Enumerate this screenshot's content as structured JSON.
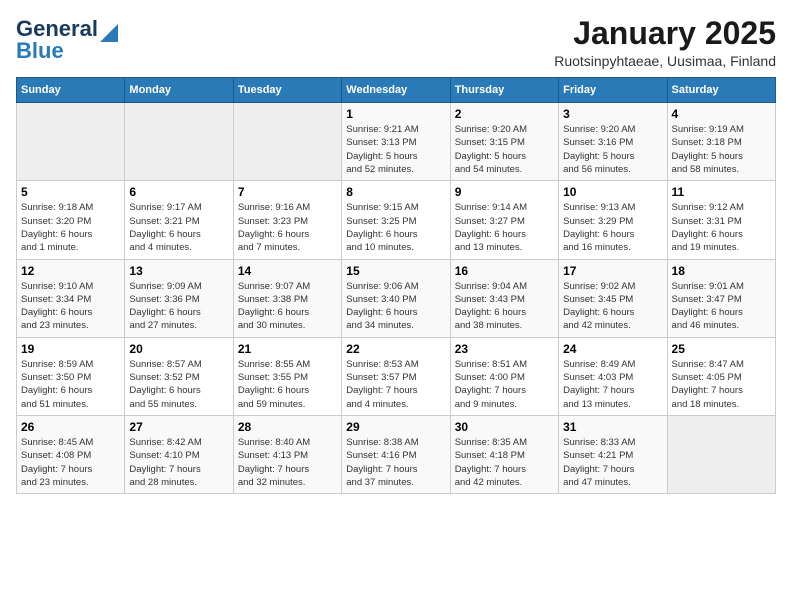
{
  "logo": {
    "line1": "General",
    "line2": "Blue"
  },
  "title": "January 2025",
  "subtitle": "Ruotsinpyhtaeae, Uusimaa, Finland",
  "days_of_week": [
    "Sunday",
    "Monday",
    "Tuesday",
    "Wednesday",
    "Thursday",
    "Friday",
    "Saturday"
  ],
  "weeks": [
    [
      {
        "day": "",
        "info": ""
      },
      {
        "day": "",
        "info": ""
      },
      {
        "day": "",
        "info": ""
      },
      {
        "day": "1",
        "info": "Sunrise: 9:21 AM\nSunset: 3:13 PM\nDaylight: 5 hours\nand 52 minutes."
      },
      {
        "day": "2",
        "info": "Sunrise: 9:20 AM\nSunset: 3:15 PM\nDaylight: 5 hours\nand 54 minutes."
      },
      {
        "day": "3",
        "info": "Sunrise: 9:20 AM\nSunset: 3:16 PM\nDaylight: 5 hours\nand 56 minutes."
      },
      {
        "day": "4",
        "info": "Sunrise: 9:19 AM\nSunset: 3:18 PM\nDaylight: 5 hours\nand 58 minutes."
      }
    ],
    [
      {
        "day": "5",
        "info": "Sunrise: 9:18 AM\nSunset: 3:20 PM\nDaylight: 6 hours\nand 1 minute."
      },
      {
        "day": "6",
        "info": "Sunrise: 9:17 AM\nSunset: 3:21 PM\nDaylight: 6 hours\nand 4 minutes."
      },
      {
        "day": "7",
        "info": "Sunrise: 9:16 AM\nSunset: 3:23 PM\nDaylight: 6 hours\nand 7 minutes."
      },
      {
        "day": "8",
        "info": "Sunrise: 9:15 AM\nSunset: 3:25 PM\nDaylight: 6 hours\nand 10 minutes."
      },
      {
        "day": "9",
        "info": "Sunrise: 9:14 AM\nSunset: 3:27 PM\nDaylight: 6 hours\nand 13 minutes."
      },
      {
        "day": "10",
        "info": "Sunrise: 9:13 AM\nSunset: 3:29 PM\nDaylight: 6 hours\nand 16 minutes."
      },
      {
        "day": "11",
        "info": "Sunrise: 9:12 AM\nSunset: 3:31 PM\nDaylight: 6 hours\nand 19 minutes."
      }
    ],
    [
      {
        "day": "12",
        "info": "Sunrise: 9:10 AM\nSunset: 3:34 PM\nDaylight: 6 hours\nand 23 minutes."
      },
      {
        "day": "13",
        "info": "Sunrise: 9:09 AM\nSunset: 3:36 PM\nDaylight: 6 hours\nand 27 minutes."
      },
      {
        "day": "14",
        "info": "Sunrise: 9:07 AM\nSunset: 3:38 PM\nDaylight: 6 hours\nand 30 minutes."
      },
      {
        "day": "15",
        "info": "Sunrise: 9:06 AM\nSunset: 3:40 PM\nDaylight: 6 hours\nand 34 minutes."
      },
      {
        "day": "16",
        "info": "Sunrise: 9:04 AM\nSunset: 3:43 PM\nDaylight: 6 hours\nand 38 minutes."
      },
      {
        "day": "17",
        "info": "Sunrise: 9:02 AM\nSunset: 3:45 PM\nDaylight: 6 hours\nand 42 minutes."
      },
      {
        "day": "18",
        "info": "Sunrise: 9:01 AM\nSunset: 3:47 PM\nDaylight: 6 hours\nand 46 minutes."
      }
    ],
    [
      {
        "day": "19",
        "info": "Sunrise: 8:59 AM\nSunset: 3:50 PM\nDaylight: 6 hours\nand 51 minutes."
      },
      {
        "day": "20",
        "info": "Sunrise: 8:57 AM\nSunset: 3:52 PM\nDaylight: 6 hours\nand 55 minutes."
      },
      {
        "day": "21",
        "info": "Sunrise: 8:55 AM\nSunset: 3:55 PM\nDaylight: 6 hours\nand 59 minutes."
      },
      {
        "day": "22",
        "info": "Sunrise: 8:53 AM\nSunset: 3:57 PM\nDaylight: 7 hours\nand 4 minutes."
      },
      {
        "day": "23",
        "info": "Sunrise: 8:51 AM\nSunset: 4:00 PM\nDaylight: 7 hours\nand 9 minutes."
      },
      {
        "day": "24",
        "info": "Sunrise: 8:49 AM\nSunset: 4:03 PM\nDaylight: 7 hours\nand 13 minutes."
      },
      {
        "day": "25",
        "info": "Sunrise: 8:47 AM\nSunset: 4:05 PM\nDaylight: 7 hours\nand 18 minutes."
      }
    ],
    [
      {
        "day": "26",
        "info": "Sunrise: 8:45 AM\nSunset: 4:08 PM\nDaylight: 7 hours\nand 23 minutes."
      },
      {
        "day": "27",
        "info": "Sunrise: 8:42 AM\nSunset: 4:10 PM\nDaylight: 7 hours\nand 28 minutes."
      },
      {
        "day": "28",
        "info": "Sunrise: 8:40 AM\nSunset: 4:13 PM\nDaylight: 7 hours\nand 32 minutes."
      },
      {
        "day": "29",
        "info": "Sunrise: 8:38 AM\nSunset: 4:16 PM\nDaylight: 7 hours\nand 37 minutes."
      },
      {
        "day": "30",
        "info": "Sunrise: 8:35 AM\nSunset: 4:18 PM\nDaylight: 7 hours\nand 42 minutes."
      },
      {
        "day": "31",
        "info": "Sunrise: 8:33 AM\nSunset: 4:21 PM\nDaylight: 7 hours\nand 47 minutes."
      },
      {
        "day": "",
        "info": ""
      }
    ]
  ]
}
